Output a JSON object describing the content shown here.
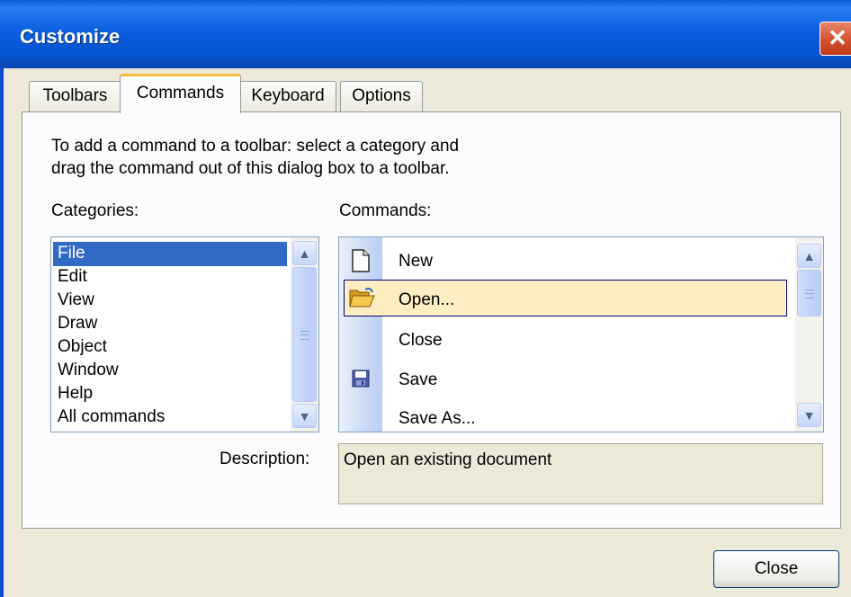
{
  "window": {
    "title": "Customize",
    "close_glyph": "✕"
  },
  "tabs": [
    {
      "label": "Toolbars",
      "active": false
    },
    {
      "label": "Commands",
      "active": true
    },
    {
      "label": "Keyboard",
      "active": false
    },
    {
      "label": "Options",
      "active": false
    }
  ],
  "instructions": [
    "To add a command to a toolbar: select a category and",
    "drag the command out of this dialog box to a toolbar."
  ],
  "categories": {
    "label": "Categories:",
    "selected": "File",
    "items": [
      "File",
      "Edit",
      "View",
      "Draw",
      "Object",
      "Window",
      "Help",
      "All commands"
    ]
  },
  "commands": {
    "label": "Commands:",
    "selected": "Open...",
    "items": [
      {
        "label": "New",
        "icon": "new-document-icon"
      },
      {
        "label": "Open...",
        "icon": "open-folder-icon"
      },
      {
        "label": "Close",
        "icon": ""
      },
      {
        "label": "Save",
        "icon": "save-disk-icon"
      },
      {
        "label": "Save As...",
        "icon": ""
      }
    ]
  },
  "description": {
    "label": "Description:",
    "text": "Open an existing document"
  },
  "buttons": {
    "close": "Close"
  },
  "colors": {
    "titlebar": "#0a5fe0",
    "selection": "#316ac5",
    "highlight": "#ffeec2",
    "tab_accent": "#f4b83a"
  }
}
